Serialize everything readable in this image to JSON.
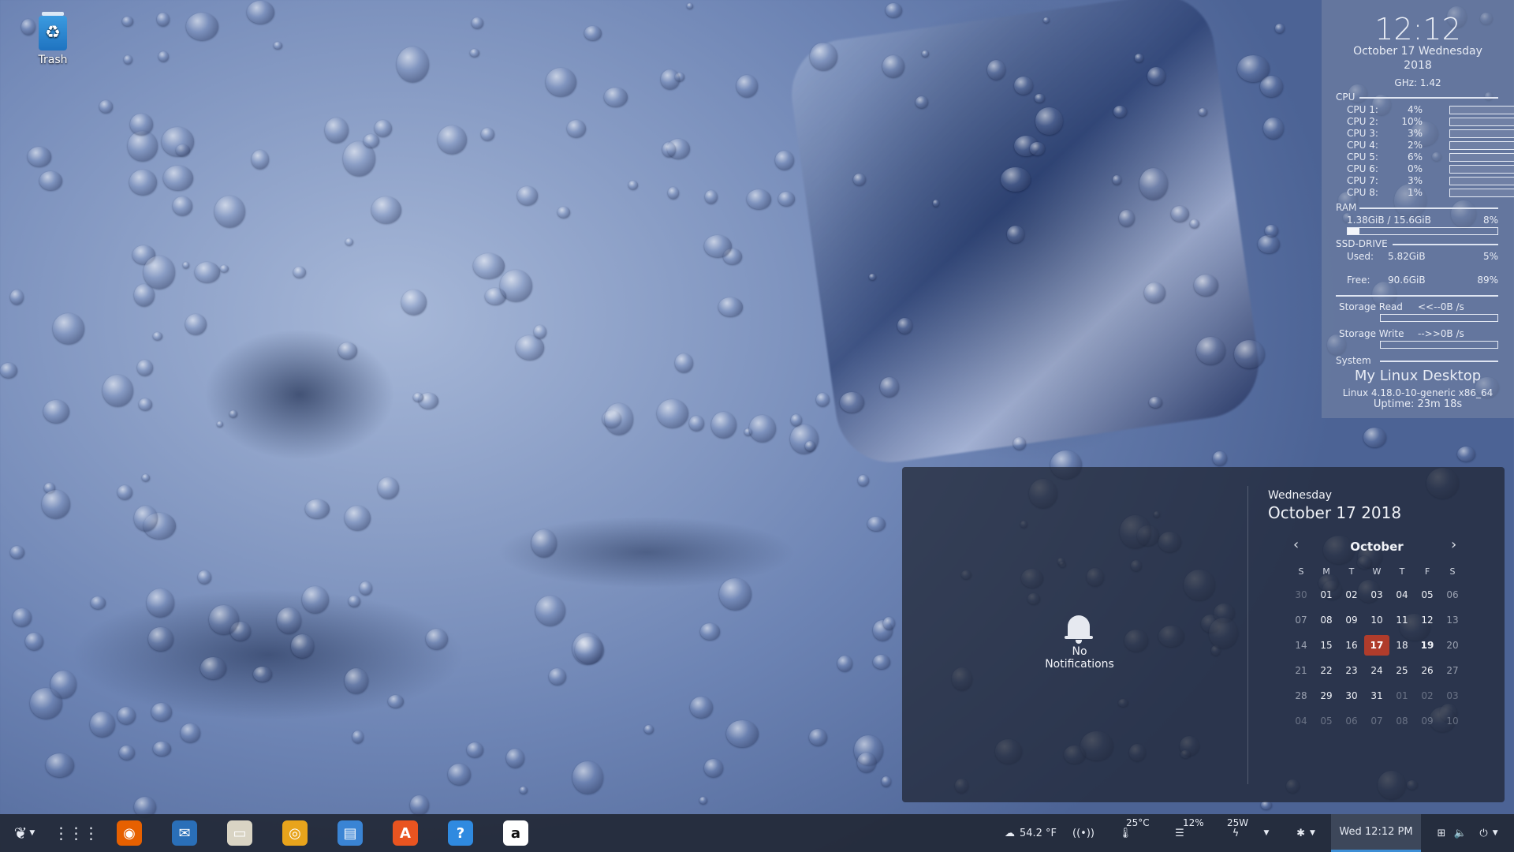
{
  "desktop": {
    "icons": [
      {
        "label": "Trash",
        "icon": "trash-icon"
      }
    ]
  },
  "conky": {
    "time": "12:12",
    "date_line1": "October 17 Wednesday",
    "date_line2": "2018",
    "ghz": "GHz: 1.42",
    "cpu_label": "CPU",
    "cpus": [
      {
        "label": "CPU 1:",
        "pct": "4%",
        "value": 4
      },
      {
        "label": "CPU 2:",
        "pct": "10%",
        "value": 10
      },
      {
        "label": "CPU 3:",
        "pct": "3%",
        "value": 3
      },
      {
        "label": "CPU 4:",
        "pct": "2%",
        "value": 2
      },
      {
        "label": "CPU 5:",
        "pct": "6%",
        "value": 6
      },
      {
        "label": "CPU 6:",
        "pct": "0%",
        "value": 0
      },
      {
        "label": "CPU 7:",
        "pct": "3%",
        "value": 3
      },
      {
        "label": "CPU 8:",
        "pct": "1%",
        "value": 1
      }
    ],
    "ram_label": "RAM",
    "ram_usage": "1.38GiB / 15.6GiB",
    "ram_pct": "8%",
    "ram_fraction": 0.08,
    "ssd_label": "SSD-DRIVE",
    "ssd_used_label": "Used:",
    "ssd_used": "5.82GiB",
    "ssd_used_pct": "5%",
    "ssd_free_label": "Free:",
    "ssd_free": "90.6GiB",
    "ssd_free_pct": "89%",
    "storage_read_label": "Storage Read",
    "storage_read": "<<--0B  /s",
    "storage_write_label": "Storage Write",
    "storage_write": "-->>0B  /s",
    "system_label": "System",
    "system_name": "My Linux Desktop",
    "kernel": "Linux 4.18.0-10-generic x86_64",
    "uptime": "Uptime: 23m 18s"
  },
  "notifications": {
    "empty_text": "No Notifications"
  },
  "calendar": {
    "weekday": "Wednesday",
    "full_date": "October 17 2018",
    "month": "October",
    "prev": "‹",
    "next": "›",
    "day_headers": [
      "S",
      "M",
      "T",
      "W",
      "T",
      "F",
      "S"
    ],
    "weeks": [
      [
        "30",
        "01",
        "02",
        "03",
        "04",
        "05",
        "06"
      ],
      [
        "07",
        "08",
        "09",
        "10",
        "11",
        "12",
        "13"
      ],
      [
        "14",
        "15",
        "16",
        "17",
        "18",
        "19",
        "20"
      ],
      [
        "21",
        "22",
        "23",
        "24",
        "25",
        "26",
        "27"
      ],
      [
        "28",
        "29",
        "30",
        "31",
        "01",
        "02",
        "03"
      ],
      [
        "04",
        "05",
        "06",
        "07",
        "08",
        "09",
        "10"
      ]
    ],
    "today": "17",
    "highlight": "19"
  },
  "taskbar": {
    "apps": [
      {
        "name": "firefox",
        "icon": "firefox-icon",
        "color": "#e66000",
        "glyph": "◉"
      },
      {
        "name": "thunderbird",
        "icon": "thunderbird-icon",
        "color": "#2a6fb8",
        "glyph": "✉"
      },
      {
        "name": "files",
        "icon": "files-icon",
        "color": "#d9d4c4",
        "glyph": "▭"
      },
      {
        "name": "rhythmbox",
        "icon": "rhythmbox-icon",
        "color": "#e8a41c",
        "glyph": "◎"
      },
      {
        "name": "libreoffice-writer",
        "icon": "writer-icon",
        "color": "#3a84d4",
        "glyph": "▤"
      },
      {
        "name": "software",
        "icon": "software-center-icon",
        "color": "#e95420",
        "glyph": "A"
      },
      {
        "name": "help",
        "icon": "help-icon",
        "color": "#2f8ae0",
        "glyph": "?"
      },
      {
        "name": "amazon",
        "icon": "amazon-icon",
        "color": "#ffffff",
        "glyph": "a"
      }
    ],
    "weather": "54.2 °F",
    "cpu_temp": "25°C",
    "disk_pct": "12%",
    "power": "25W",
    "clock": "Wed 12:12 PM"
  }
}
